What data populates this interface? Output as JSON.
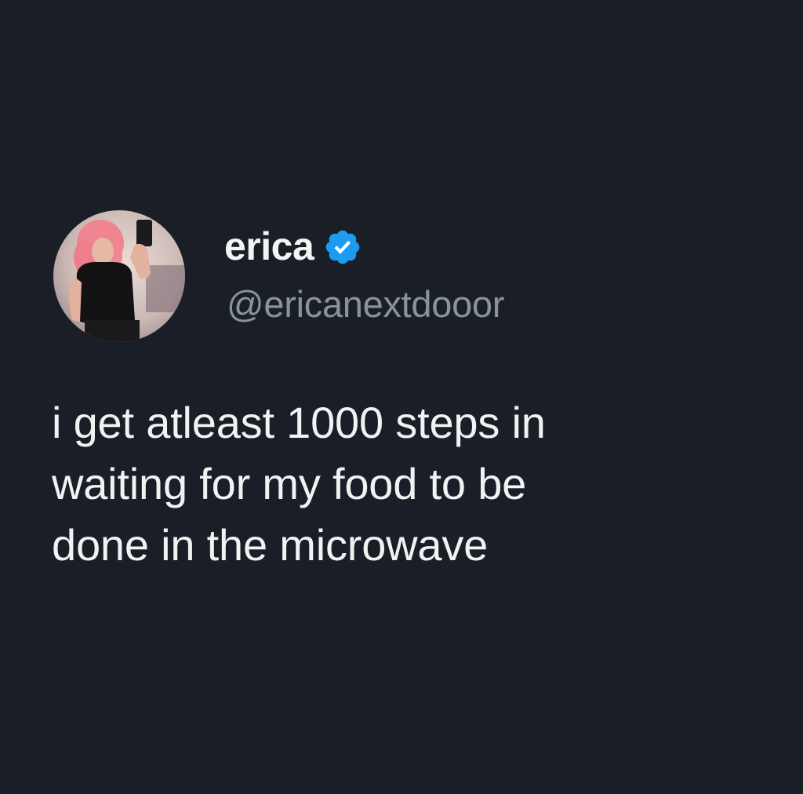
{
  "tweet": {
    "author": {
      "display_name": "erica",
      "handle": "@ericanextdooor",
      "verified": true,
      "verified_icon": "verified-badge-icon",
      "avatar_icon": "profile-photo"
    },
    "text_lines": [
      "i get atleast 1000 steps in",
      "waiting for my food to be",
      "done in the microwave"
    ]
  },
  "colors": {
    "background": "#1a1f27",
    "text": "#f2f2f2",
    "handle": "#8a929c",
    "verified_blue": "#1d9bf0"
  }
}
